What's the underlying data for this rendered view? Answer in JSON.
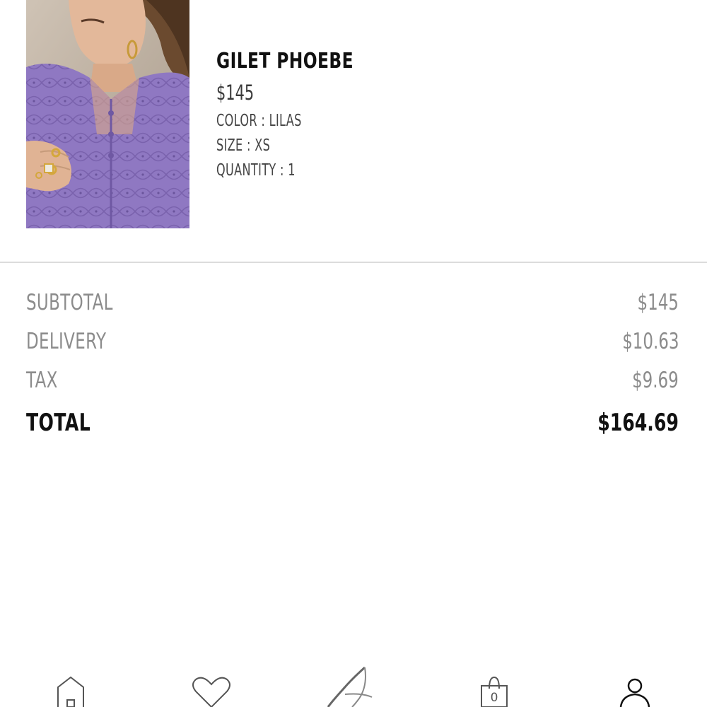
{
  "product": {
    "name": "GILET PHOEBE",
    "price": "$145",
    "color": "COLOR : LILAS",
    "size": "SIZE : XS",
    "quantity": "QUANTITY : 1",
    "image_icon": "product-photo"
  },
  "summary": {
    "rows": [
      {
        "label": "SUBTOTAL",
        "value": "$145"
      },
      {
        "label": "DELIVERY",
        "value": "$10.63"
      },
      {
        "label": "TAX",
        "value": "$9.69"
      }
    ],
    "total": {
      "label": "TOTAL",
      "value": "$164.69"
    }
  },
  "nav": {
    "items": [
      {
        "icon": "home-icon"
      },
      {
        "icon": "heart-icon"
      },
      {
        "icon": "brand-logo-icon"
      },
      {
        "icon": "shopping-bag-icon",
        "count": "0"
      },
      {
        "icon": "user-icon"
      }
    ]
  },
  "colors": {
    "text_primary": "#111111",
    "text_muted": "#8c8c8c",
    "divider": "#dcdcdc",
    "product_lilac": "#8a72b8"
  }
}
